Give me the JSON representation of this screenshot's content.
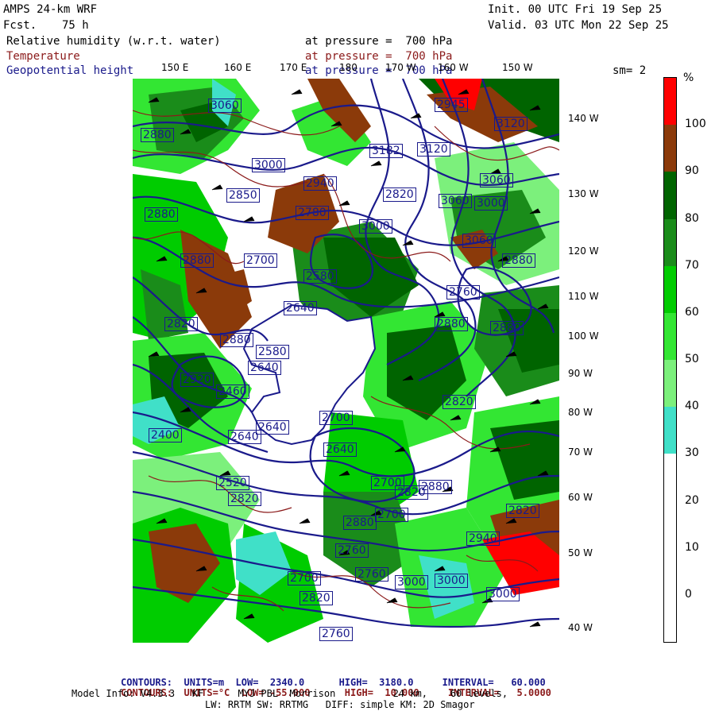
{
  "header": {
    "model": "AMPS 24-km WRF",
    "fcst_label": "Fcst.",
    "fcst_value": "75 h",
    "init": "Init. 00 UTC Fri 19 Sep 25",
    "valid": "Valid. 03 UTC Mon 22 Sep 25",
    "fields": [
      {
        "name": "Relative humidity (w.r.t. water)",
        "level": "at pressure =  700 hPa",
        "color": "#000000"
      },
      {
        "name": "Temperature",
        "level": "at pressure =  700 hPa",
        "color": "#8b1a1a"
      },
      {
        "name": "Geopotential height",
        "level": "at pressure =  700 hPa",
        "color": "#1a1a8b"
      }
    ],
    "smoothing": "sm= 2"
  },
  "map": {
    "longitude_labels_top": [
      "150 E",
      "160 E",
      "170 E",
      "180",
      "170 W",
      "160 W",
      "150 W"
    ],
    "longitude_labels_right": [
      "140 W",
      "130 W",
      "120 W",
      "110 W",
      "100 W",
      "90 W",
      "80 W",
      "70 W",
      "60 W",
      "50 W",
      "40 W"
    ],
    "height_contour_labels": [
      "3060",
      "2880",
      "3000",
      "2880",
      "2940",
      "3182",
      "3120",
      "2945",
      "3120",
      "3060",
      "2850",
      "2820",
      "2780",
      "3000",
      "3000",
      "3060",
      "2880",
      "2700",
      "2880",
      "2920",
      "2880",
      "2820",
      "2580",
      "2640",
      "2760",
      "2880",
      "2580",
      "2640",
      "2880",
      "2460",
      "2400",
      "2820",
      "2700",
      "2640",
      "2640",
      "2520",
      "2820",
      "2880",
      "2940",
      "2700",
      "2760",
      "2820",
      "2760",
      "2700",
      "2880",
      "2820",
      "2760",
      "3000",
      "3000",
      "3000",
      "3060",
      "2640",
      "2700",
      "2820"
    ],
    "colors": {
      "height_contour": "#1a1a8b",
      "temperature_contour": "#8b1a1a",
      "wind_barb": "#000000",
      "continent": "#ffffff"
    }
  },
  "colorbar": {
    "unit": "%",
    "labels": [
      "100",
      "90",
      "80",
      "70",
      "60",
      "50",
      "40",
      "30",
      "20",
      "10",
      "0"
    ],
    "bins": [
      {
        "color": "#ff0000"
      },
      {
        "color": "#8b3a0a"
      },
      {
        "color": "#006400"
      },
      {
        "color": "#1a8c1a"
      },
      {
        "color": "#00cc00"
      },
      {
        "color": "#33e633"
      },
      {
        "color": "#7cf07c"
      },
      {
        "color": "#40e0c8"
      },
      {
        "color": "#ffffff"
      },
      {
        "color": "#ffffff"
      },
      {
        "color": "#ffffff"
      },
      {
        "color": "#ffffff"
      }
    ]
  },
  "footer": {
    "c1_label": "CONTOURS:",
    "c1_units": "UNITS=m",
    "c1_low": "LOW=  2340.0",
    "c1_high": "HIGH=  3180.0",
    "c1_interval": "INTERVAL=   60.000",
    "c2_label": "CONTOURS:",
    "c2_units": "UNITS=°C",
    "c2_low": "LOW= -55.000",
    "c2_high": "HIGH=  10.000",
    "c2_interval": "INTERVAL=   5.0000",
    "model_info": "Model Info: V4.3.3   KF      MYJ PBL  Morrison          24 km,    60 levels,",
    "physics": "LW: RRTM SW: RRTMG   DIFF: simple KM: 2D Smagor"
  }
}
